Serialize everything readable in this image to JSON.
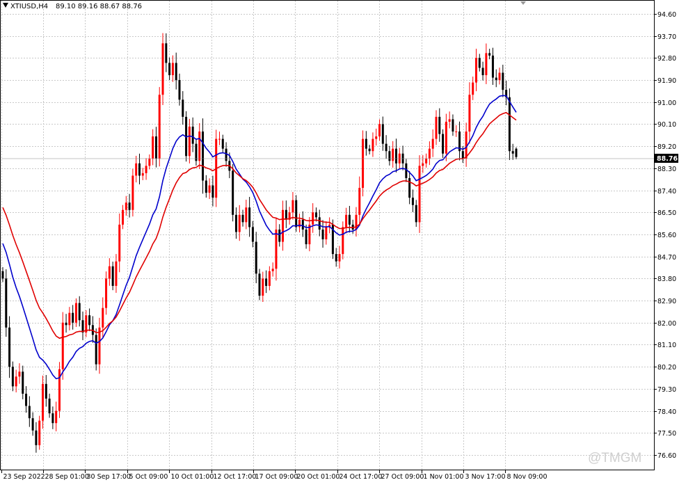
{
  "header": {
    "symbol": "XTIUSD,H4",
    "ohlc": "89.10 89.16 88.67 88.76"
  },
  "watermark": "@TMGM",
  "current_price": "88.76",
  "colors": {
    "bull": "#ff0000",
    "bear": "#000000",
    "ma_fast": "#0000cc",
    "ma_slow": "#e00000",
    "grid": "#c8c8c8",
    "price_tag_bg": "#000000"
  },
  "chart_data": {
    "type": "candlestick",
    "symbol": "XTIUSD",
    "timeframe": "H4",
    "ylim": [
      76.4,
      95.0
    ],
    "y_ticks": [
      "94.60",
      "93.70",
      "92.80",
      "91.90",
      "91.00",
      "90.10",
      "89.20",
      "88.30",
      "87.40",
      "86.50",
      "85.60",
      "84.70",
      "83.80",
      "82.90",
      "82.00",
      "81.10",
      "80.20",
      "79.30",
      "78.40",
      "77.50",
      "76.60"
    ],
    "x_tick_labels": [
      "23 Sep 2022",
      "28 Sep 01:00",
      "30 Sep 17:00",
      "5 Oct 09:00",
      "10 Oct 01:00",
      "12 Oct 17:00",
      "17 Oct 09:00",
      "20 Oct 01:00",
      "24 Oct 17:00",
      "27 Oct 09:00",
      "1 Nov 01:00",
      "3 Nov 17:00",
      "8 Nov 09:00"
    ],
    "last_ohlc": {
      "open": 89.1,
      "high": 89.16,
      "low": 88.67,
      "close": 88.76
    },
    "closes": [
      83.8,
      81.8,
      80.2,
      79.4,
      79.8,
      80.0,
      79.1,
      78.6,
      78.1,
      77.6,
      77.0,
      78.0,
      79.5,
      78.9,
      78.3,
      77.9,
      78.4,
      80.1,
      82.0,
      81.9,
      82.4,
      82.0,
      82.8,
      82.1,
      81.6,
      82.3,
      81.9,
      81.5,
      80.3,
      81.8,
      82.6,
      83.8,
      84.3,
      83.5,
      84.5,
      86.0,
      86.6,
      86.9,
      86.6,
      88.0,
      88.5,
      88.0,
      88.1,
      88.4,
      88.7,
      89.6,
      88.7,
      91.3,
      93.4,
      92.6,
      92.1,
      92.6,
      91.9,
      91.1,
      90.4,
      88.8,
      90.0,
      89.3,
      88.6,
      89.8,
      87.8,
      87.3,
      87.6,
      87.1,
      89.5,
      89.5,
      89.1,
      88.6,
      88.2,
      86.4,
      85.7,
      86.4,
      86.1,
      86.7,
      85.9,
      85.3,
      84.0,
      83.1,
      83.8,
      83.5,
      84.1,
      84.2,
      85.8,
      85.3,
      86.6,
      86.2,
      86.5,
      87.0,
      85.9,
      86.2,
      85.8,
      85.2,
      86.0,
      86.5,
      86.3,
      85.8,
      85.4,
      85.9,
      86.0,
      84.8,
      84.5,
      84.8,
      85.9,
      86.4,
      86.0,
      85.8,
      86.4,
      87.5,
      89.5,
      89.1,
      89.0,
      89.5,
      89.6,
      90.1,
      89.3,
      89.0,
      88.6,
      89.1,
      88.5,
      88.9,
      88.5,
      87.9,
      87.1,
      86.8,
      86.1,
      88.4,
      88.5,
      88.7,
      89.1,
      89.5,
      90.4,
      89.7,
      88.9,
      90.2,
      90.3,
      89.8,
      89.8,
      89.0,
      88.7,
      89.8,
      91.3,
      91.8,
      92.8,
      92.4,
      92.1,
      93.0,
      92.9,
      92.0,
      91.9,
      92.2,
      91.5,
      91.2,
      89.0,
      88.9,
      88.76
    ],
    "ma_fast_label": "blue moving average",
    "ma_slow_label": "red moving average"
  }
}
